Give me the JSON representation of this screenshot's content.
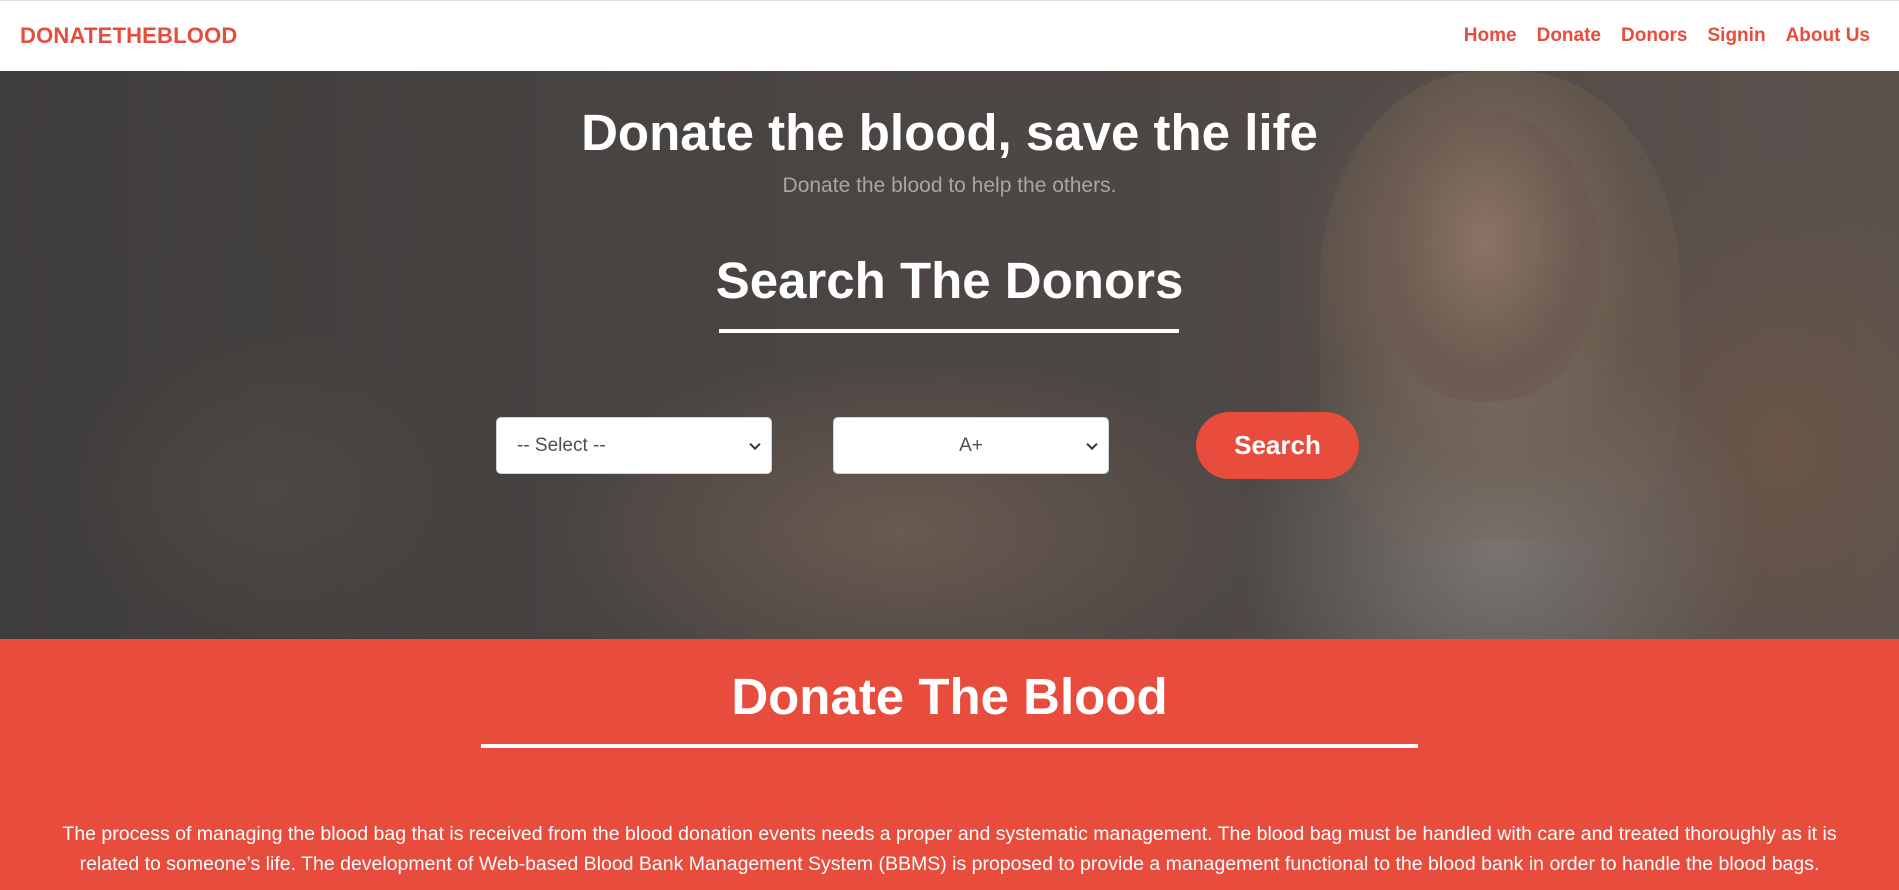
{
  "colors": {
    "accent": "#e74c3c",
    "nav_bg": "#ffffff",
    "hero_overlay": "#3f3d3c",
    "text_light": "#ffffff",
    "subtitle": "#a6a6a6"
  },
  "navbar": {
    "brand": "DONATETHEBLOOD",
    "links": [
      {
        "label": "Home"
      },
      {
        "label": "Donate"
      },
      {
        "label": "Donors"
      },
      {
        "label": "Signin"
      },
      {
        "label": "About Us"
      }
    ]
  },
  "hero": {
    "title": "Donate the blood, save the life",
    "subtitle": "Donate the blood to help the others.",
    "search_title": "Search The Donors",
    "city_select": {
      "value": "-- Select --"
    },
    "blood_group_select": {
      "value": "A+"
    },
    "search_button": "Search"
  },
  "about": {
    "title": "Donate The Blood",
    "text": "The process of managing the blood bag that is received from the blood donation events needs a proper and systematic management. The blood bag must be handled with care and treated thoroughly as it is related to someone’s life. The development of Web-based Blood Bank Management System (BBMS) is proposed to provide a management functional to the blood bank in order to handle the blood bags."
  }
}
